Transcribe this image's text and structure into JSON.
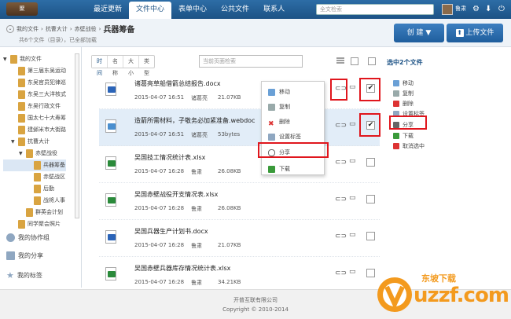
{
  "topbar": {
    "logo_text": "聚",
    "nav": [
      "最近更新",
      "文件中心",
      "表单中心",
      "公共文件",
      "联系人"
    ],
    "active_nav": 1,
    "search_placeholder": "全文检索",
    "user_name": "鲁肃"
  },
  "pathbar": {
    "breadcrumbs": [
      "我的文件",
      "抗曹大计",
      "赤壁战役"
    ],
    "current": "兵器筹备",
    "count_text": "共6个文件（目录），已全部加载",
    "create_label": "创  建",
    "upload_label": "上传文件"
  },
  "sidebar": {
    "tree": [
      {
        "label": "我的文件",
        "level": 0,
        "toggle": "▼"
      },
      {
        "label": "第三届东吴运动",
        "level": 1,
        "toggle": ""
      },
      {
        "label": "东吴官员犯律巡",
        "level": 1,
        "toggle": ""
      },
      {
        "label": "东吴三大洋核式",
        "level": 1,
        "toggle": ""
      },
      {
        "label": "东吴行政文件",
        "level": 1,
        "toggle": ""
      },
      {
        "label": "国太七十大寿筹",
        "level": 1,
        "toggle": ""
      },
      {
        "label": "建邺米市大街路",
        "level": 1,
        "toggle": ""
      },
      {
        "label": "抗曹大计",
        "level": 1,
        "toggle": "▼"
      },
      {
        "label": "赤壁战役",
        "level": 2,
        "toggle": "▼"
      },
      {
        "label": "兵器筹备",
        "level": 3,
        "toggle": ""
      },
      {
        "label": "赤壁战区",
        "level": 3,
        "toggle": ""
      },
      {
        "label": "后勤",
        "level": 3,
        "toggle": ""
      },
      {
        "label": "战将人事",
        "level": 3,
        "toggle": ""
      },
      {
        "label": "群英会计划",
        "level": 2,
        "toggle": ""
      },
      {
        "label": "同学聚会照片",
        "level": 1,
        "toggle": ""
      }
    ],
    "groups": [
      "我的协作组",
      "我的分享",
      "我的标签"
    ]
  },
  "toolbar": {
    "sort_tabs": [
      "时间",
      "名称",
      "大小",
      "类型"
    ],
    "page_search_placeholder": "当前页面检索"
  },
  "files": [
    {
      "name": "诸葛亮草船借箭总结报告.docx",
      "date": "2015-04-07 16:51",
      "owner": "诸葛亮",
      "size": "21.07KB",
      "type": "word",
      "selected": false,
      "checked": true
    },
    {
      "name": "造箭所需材料，子敬务必加紧准备.webdoc",
      "date": "2015-04-07 16:51",
      "owner": "诸葛亮",
      "size": "53bytes",
      "type": "webdoc",
      "selected": true,
      "checked": true
    },
    {
      "name": "吴国技工情况统计表.xlsx",
      "date": "2015-04-07 16:28",
      "owner": "鲁肃",
      "size": "26.08KB",
      "type": "excel",
      "selected": false,
      "checked": false
    },
    {
      "name": "吴国赤壁战役开支情况表.xlsx",
      "date": "2015-04-07 16:28",
      "owner": "鲁肃",
      "size": "26.08KB",
      "type": "excel",
      "selected": false,
      "checked": false
    },
    {
      "name": "吴国兵器生产计划书.docx",
      "date": "2015-04-07 16:28",
      "owner": "鲁肃",
      "size": "21.07KB",
      "type": "word",
      "selected": false,
      "checked": false
    },
    {
      "name": "吴国赤壁兵器库存情况统计表.xlsx",
      "date": "2015-04-07 16:28",
      "owner": "鲁肃",
      "size": "34.21KB",
      "type": "excel",
      "selected": false,
      "checked": false
    }
  ],
  "context_menu": [
    "移动",
    "复制",
    "删除",
    "设置标签",
    "分享",
    "下载"
  ],
  "right_panel": {
    "title": "选中2个文件",
    "actions": [
      "移动",
      "复制",
      "删除",
      "设置标签",
      "分享",
      "下载",
      "取消选中"
    ]
  },
  "footer": {
    "company": "开普互联有限公司",
    "copyright": "Copyright © 2010-2014"
  },
  "watermark": {
    "text": "uzzf.com",
    "cn": "东坡下载"
  },
  "colors": {
    "topbar": "#1c5285",
    "accent_red": "#e0161d",
    "selected_row": "#e2edf8",
    "watermark_orange": "#f39a1e"
  }
}
